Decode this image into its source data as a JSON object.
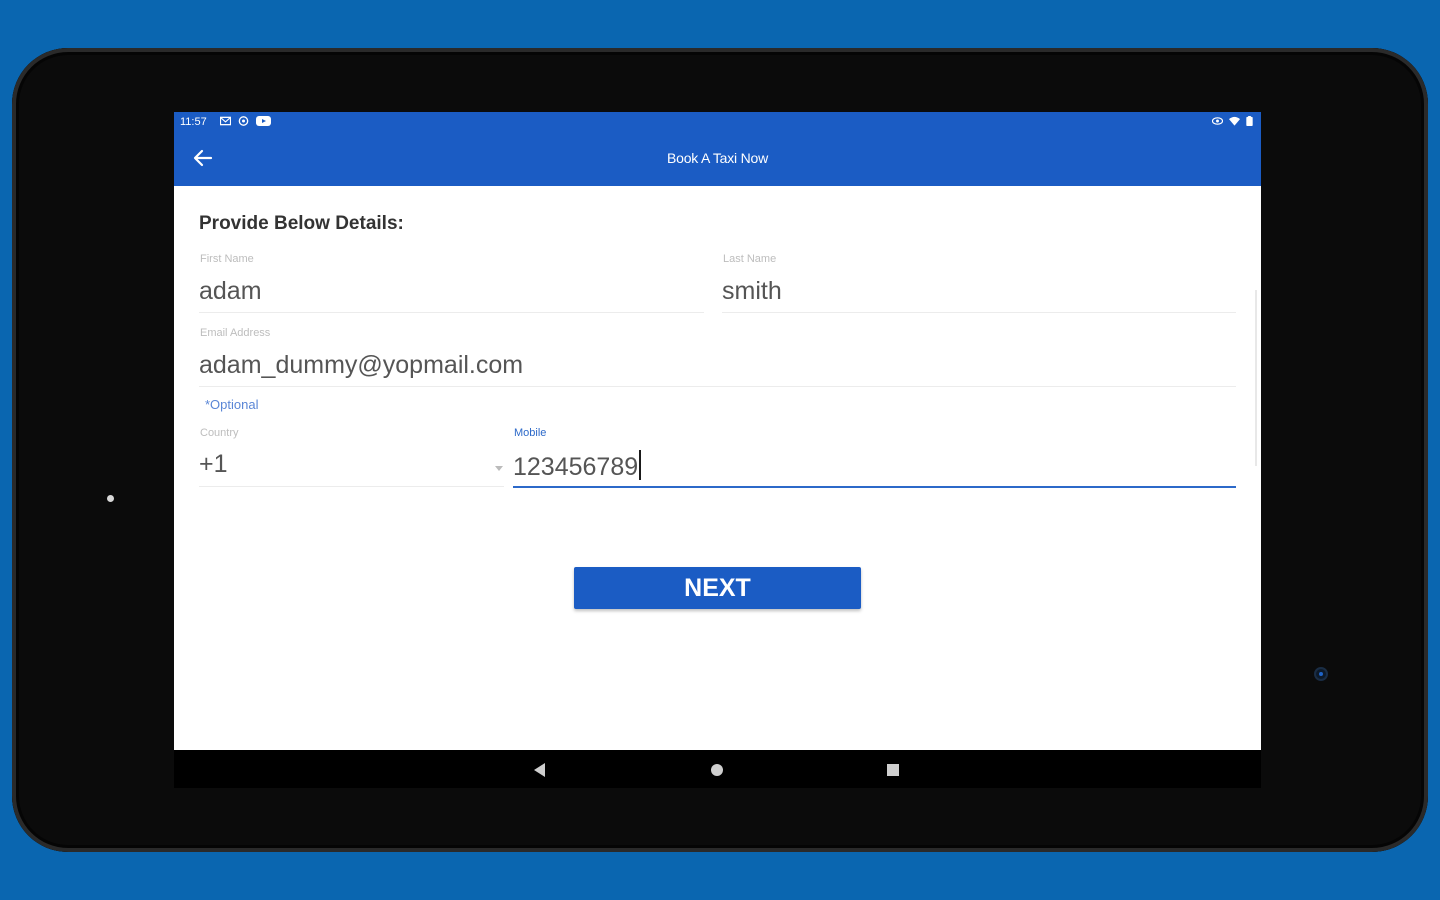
{
  "status_bar": {
    "time": "11:57",
    "left_icons": [
      "mail-icon",
      "sync-icon",
      "youtube-icon"
    ],
    "right_icons": [
      "eye-icon",
      "wifi-icon",
      "battery-icon"
    ]
  },
  "app_bar": {
    "title": "Book A Taxi Now",
    "back_icon": "arrow-left-icon"
  },
  "form": {
    "section_title": "Provide Below Details:",
    "first_name": {
      "label": "First Name",
      "value": "adam"
    },
    "last_name": {
      "label": "Last Name",
      "value": "smith"
    },
    "email": {
      "label": "Email Address",
      "value": "adam_dummy@yopmail.com"
    },
    "optional_note": "*Optional",
    "country": {
      "label": "Country",
      "value": "+1"
    },
    "mobile": {
      "label": "Mobile",
      "value": "123456789"
    }
  },
  "actions": {
    "next_label": "NEXT"
  },
  "colors": {
    "primary": "#1b5cc4",
    "background": "#0a66b0",
    "active_field": "#2c69c9"
  },
  "nav_bar": {
    "icons": [
      "nav-back-icon",
      "nav-home-icon",
      "nav-recents-icon"
    ]
  }
}
